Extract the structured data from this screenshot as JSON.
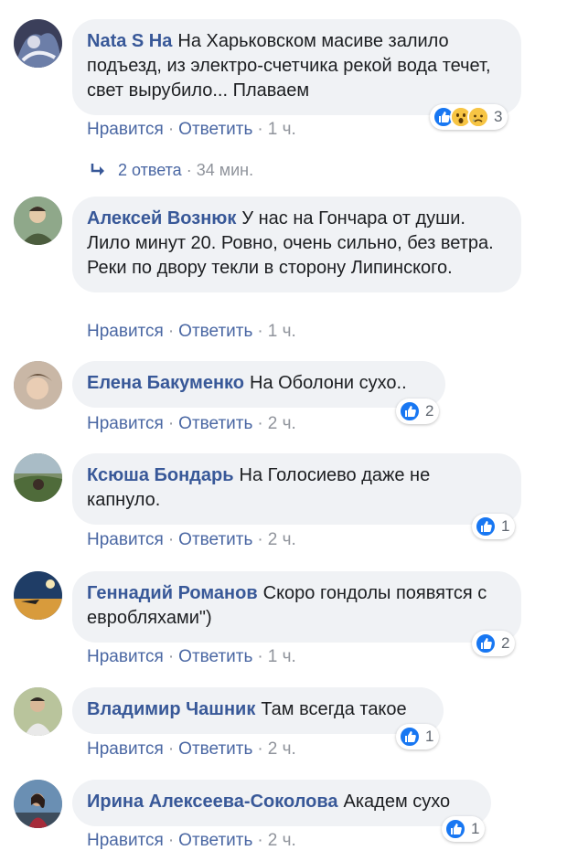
{
  "labels": {
    "like": "Нравится",
    "reply": "Ответить",
    "dot": "·"
  },
  "colors": {
    "author": "#385898",
    "link": "#4a67a3",
    "bubble": "#f0f2f5",
    "like_blue": "#1877f2",
    "muted": "#90949c"
  },
  "comments": [
    {
      "author": "Nata S Ha",
      "text": "На Харьковском масиве залило подъезд, из электро-счетчика рекой вода течет, свет вырубило... Плаваем",
      "time": "1 ч.",
      "reactions": [
        "like-icon",
        "wow-icon",
        "sad-icon"
      ],
      "reaction_count": "3"
    },
    {
      "author": "Алексей Вознюк",
      "text": "У нас на Гончара от души. Лило минут 20. Ровно, очень сильно, без ветра. Реки по двору текли в сторону Липинского.",
      "time": "1 ч.",
      "reactions": [],
      "reaction_count": ""
    },
    {
      "author": "Елена Бакуменко",
      "text": "На Оболони сухо..",
      "time": "2 ч.",
      "reactions": [
        "like-icon"
      ],
      "reaction_count": "2"
    },
    {
      "author": "Ксюша Бондарь",
      "text": "На Голосиево даже не капнуло.",
      "time": "2 ч.",
      "reactions": [
        "like-icon"
      ],
      "reaction_count": "1"
    },
    {
      "author": "Геннадий Романов",
      "text": "Скоро гондолы появятся с евробляхами\")",
      "time": "1 ч.",
      "reactions": [
        "like-icon"
      ],
      "reaction_count": "2"
    },
    {
      "author": "Владимир Чашник",
      "text": "Там всегда такое",
      "time": "2 ч.",
      "reactions": [
        "like-icon"
      ],
      "reaction_count": "1"
    },
    {
      "author": "Ирина Алексеева-Соколова",
      "text": "Академ сухо",
      "time": "2 ч.",
      "reactions": [
        "like-icon"
      ],
      "reaction_count": "1"
    }
  ],
  "replies": {
    "label": "2 ответа",
    "time": "34 мин."
  }
}
